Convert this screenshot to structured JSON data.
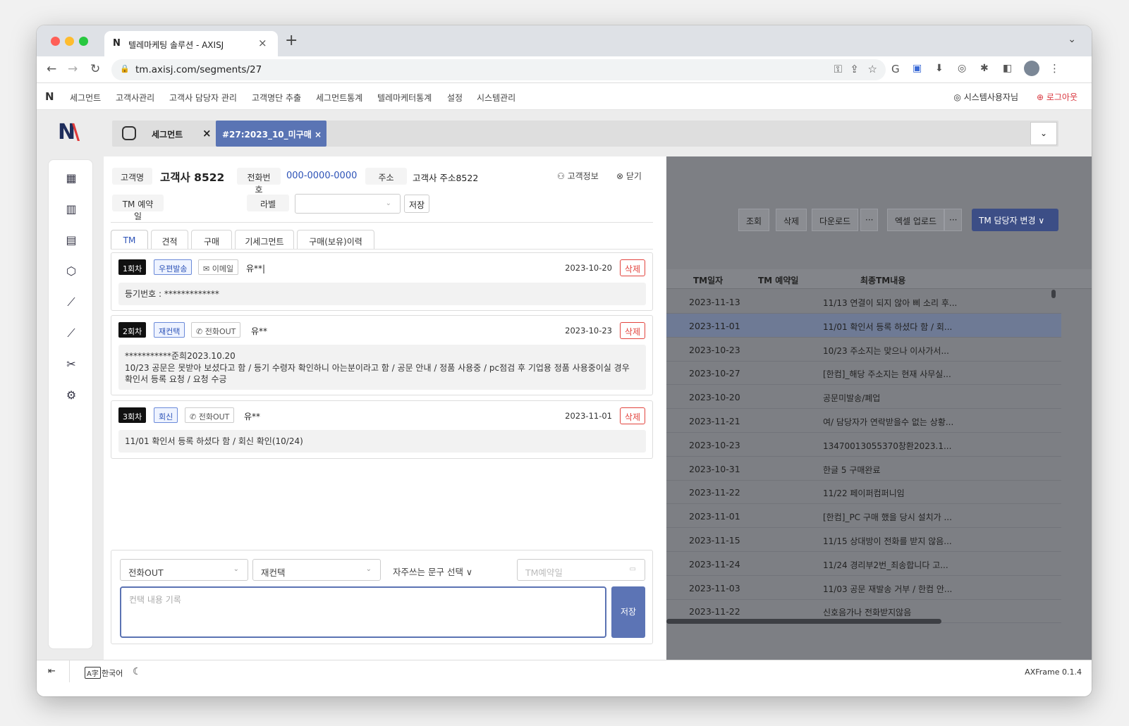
{
  "browser": {
    "tab_title": "텔레마케팅 솔루션 - AXISJ",
    "tab_favicon": "N",
    "url": "tm.axisj.com/segments/27"
  },
  "menubar": {
    "items": [
      "세그먼트",
      "고객사관리",
      "고객사 담당자 관리",
      "고객명단 추출",
      "세그먼트통계",
      "텔레마케터통계",
      "설정",
      "시스템관리"
    ],
    "user": "시스템사용자님",
    "logout": "로그아웃"
  },
  "tabstrip": {
    "home_label": "세그먼트",
    "active_tab": "#27:2023_10_미구매 ×"
  },
  "customer": {
    "name_label": "고객명",
    "name": "고객사 8522",
    "phone_label": "전화번호",
    "phone": "000-0000-0000",
    "address_label": "주소",
    "address": "고객사 주소8522",
    "info_link": "고객정보",
    "close_link": "닫기",
    "tm_reserve_label": "TM 예약일",
    "label_label": "라벨",
    "label_save": "저장"
  },
  "detail_tabs": [
    "TM",
    "견적",
    "구매",
    "기세그먼트",
    "구매(보유)이력"
  ],
  "records": [
    {
      "round": "1회차",
      "type": "우편발송",
      "channel": "이메일",
      "who": "유**|",
      "date": "2023-10-20",
      "delete": "삭제",
      "body": "등기번호 : *************"
    },
    {
      "round": "2회차",
      "type": "재컨택",
      "channel": "전화OUT",
      "who": "유**",
      "date": "2023-10-23",
      "delete": "삭제",
      "body": "***********준희2023.10.20\n10/23 공문은 못받아 보셨다고 함 / 등기 수령자 확인하니 아는분이라고 함 / 공문 안내 / 정품 사용중 / pc점검 후 기업용 정품 사용중이실 경우 확인서 등록 요청 / 요청 수긍"
    },
    {
      "round": "3회차",
      "type": "회신",
      "channel": "전화OUT",
      "who": "유**",
      "date": "2023-11-01",
      "delete": "삭제",
      "body": "11/01 확인서 등록 하셨다 함 / 회신 확인(10/24)"
    }
  ],
  "composer": {
    "channel": "전화OUT",
    "type": "재컨택",
    "phrase": "자주쓰는 문구 선택 ∨",
    "date_placeholder": "TM예약일",
    "text_placeholder": "컨택 내용 기록",
    "save": "저장"
  },
  "grid": {
    "buttons": [
      "조회",
      "삭제",
      "다운로드",
      "···",
      "엑셀 업로드",
      "···"
    ],
    "change_button": "TM 담당자 변경 ∨",
    "columns": [
      "TM일자",
      "TM 예약일",
      "최종TM내용"
    ],
    "rows": [
      {
        "date": "2023-11-13",
        "content": "11/13 연결이 되지 않아 삐 소리 후..."
      },
      {
        "date": "2023-11-01",
        "content": "11/01 확인서 등록 하셨다 함 / 회..."
      },
      {
        "date": "2023-10-23",
        "content": "10/23 주소지는 맞으나 이사가서..."
      },
      {
        "date": "2023-10-27",
        "content": "[한컴]_해당 주소지는 현재 사무실..."
      },
      {
        "date": "2023-10-20",
        "content": "공문미발송/폐업"
      },
      {
        "date": "2023-11-21",
        "content": "여/ 담당자가 연락받을수 없는 상황..."
      },
      {
        "date": "2023-10-23",
        "content": "13470013055370창환2023.1..."
      },
      {
        "date": "2023-10-31",
        "content": "한글 5 구매완료"
      },
      {
        "date": "2023-11-22",
        "content": "11/22 페이퍼컴퍼니임"
      },
      {
        "date": "2023-11-01",
        "content": "[한컴]_PC 구매 했을 당시 설치가 ..."
      },
      {
        "date": "2023-11-15",
        "content": "11/15 상대방이 전화를 받지 않음..."
      },
      {
        "date": "2023-11-24",
        "content": "11/24 경리부2번_죄송합니다 고..."
      },
      {
        "date": "2023-11-03",
        "content": "11/03 공문 재발송 거부 / 한컴 안..."
      },
      {
        "date": "2023-11-22",
        "content": "신호음가나 전화받지않음"
      }
    ]
  },
  "footer": {
    "language": "한국어",
    "version": "AXFrame 0.1.4"
  },
  "colors": {
    "accent": "#5a74b4",
    "danger": "#e2433d",
    "phone": "#2c52b7"
  }
}
